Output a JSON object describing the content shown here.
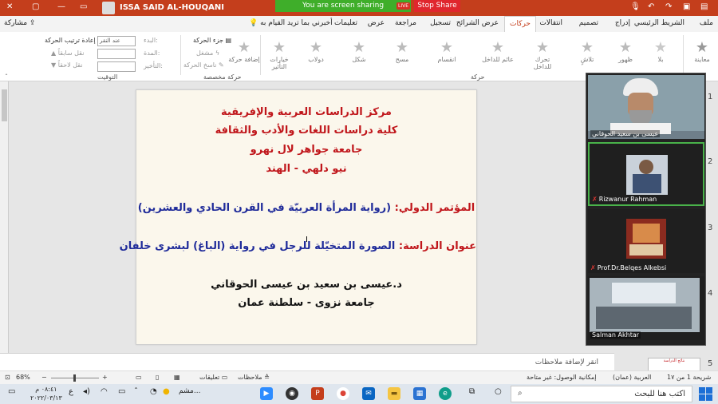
{
  "titlebar": {
    "user_name": "ISSA SAID AL-HOUQANI",
    "share_banner": "You are screen sharing",
    "live": "LIVE",
    "stop_share": "Stop Share",
    "help_hint": "أخبرني بما تريد القيام به",
    "share": "مشاركة"
  },
  "tabs": [
    "ملف",
    "الشريط الرئيسي",
    "إدراج",
    "تصميم",
    "انتقالات",
    "حركات",
    "عرض الشرائح",
    "تسجيل",
    "مراجعة",
    "عرض",
    "تعليمات"
  ],
  "active_tab": "حركات",
  "ribbon": {
    "preview": "معاينة",
    "animations": [
      "بلا",
      "ظهور",
      "تلاشٍ",
      "تحرك للداخل",
      "عائم للداخل",
      "انقسام",
      "مسح",
      "شكل",
      "دولاب"
    ],
    "effect_options": "خيارات التأثير",
    "add_animation": "إضافة حركة",
    "animation_pane": "جزء الحركة",
    "trigger": "مشغل",
    "animation_painter": "ناسخ الحركة",
    "start_label": "البدء:",
    "start_value": "عند النقر",
    "duration_label": "المدة:",
    "delay_label": "التأخير:",
    "reorder": "إعادة ترتيب الحركة",
    "move_earlier": "نقل سابقاً",
    "move_later": "نقل لاحقاً",
    "group_animation": "حركة",
    "group_advanced": "حركة مخصصة",
    "group_timing": "التوقيت"
  },
  "slide": {
    "line1": "مركز الدراسات العربية والإفريقية",
    "line2": "كلية دراسات اللغات والأدب  والثقافة",
    "line3": "جامعة جواهر لال نهرو",
    "line4": "نيو دلهي - الهند",
    "conf_label": "المؤتمر الدولي:",
    "conf_value": "(رواية المرأة العربيّة في القرن الحادي والعشرين)",
    "study_label": "عنوان الدراسة:",
    "study_value": "الصورة المتخيّلة للرجل في رواية (الباغ) لبشرى خلفان",
    "author": "د.عيسى بن سعيد بن عيسى الحوقاني",
    "affiliation": "جامعة نزوى - سلطنة عمان"
  },
  "thumbnails": [
    "1",
    "2",
    "3",
    "4",
    "5"
  ],
  "thumb5_text": "نتائج الدراسة",
  "video": [
    {
      "name": "عيسى بن سعيد الحوقاني",
      "muted": false,
      "active": false
    },
    {
      "name": "Rizwanur Rahman",
      "muted": true,
      "active": true
    },
    {
      "name": "Prof.Dr.Belqes Alkebsi",
      "muted": true,
      "active": false
    },
    {
      "name": "Salman Akhtar",
      "muted": false,
      "active": false
    }
  ],
  "notes_placeholder": "انقر لإضافة ملاحظات",
  "status": {
    "slide_counter": "شريحة 1 من 1٧",
    "language": "العربية (عمان)",
    "accessibility": "إمكانية الوصول: غير متاحة",
    "notes": "ملاحظات",
    "comments": "تعليقات",
    "zoom": "68%"
  },
  "taskbar": {
    "search_placeholder": "اكتب هنا للبحث",
    "time": "٠٨:٤١ م",
    "date": "٢٠٢٢/٠٣/١٣",
    "weather": "مشم...",
    "lang": "ع"
  }
}
